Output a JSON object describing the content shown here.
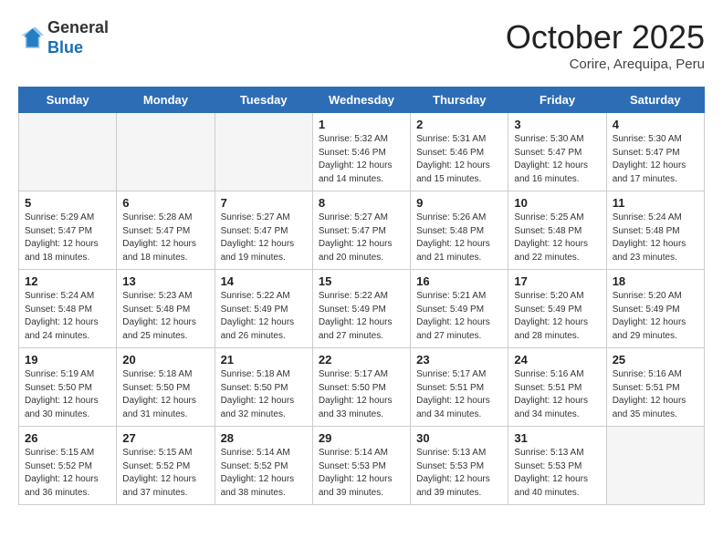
{
  "header": {
    "logo_general": "General",
    "logo_blue": "Blue",
    "month": "October 2025",
    "location": "Corire, Arequipa, Peru"
  },
  "weekdays": [
    "Sunday",
    "Monday",
    "Tuesday",
    "Wednesday",
    "Thursday",
    "Friday",
    "Saturday"
  ],
  "weeks": [
    [
      {
        "day": "",
        "info": ""
      },
      {
        "day": "",
        "info": ""
      },
      {
        "day": "",
        "info": ""
      },
      {
        "day": "1",
        "info": "Sunrise: 5:32 AM\nSunset: 5:46 PM\nDaylight: 12 hours\nand 14 minutes."
      },
      {
        "day": "2",
        "info": "Sunrise: 5:31 AM\nSunset: 5:46 PM\nDaylight: 12 hours\nand 15 minutes."
      },
      {
        "day": "3",
        "info": "Sunrise: 5:30 AM\nSunset: 5:47 PM\nDaylight: 12 hours\nand 16 minutes."
      },
      {
        "day": "4",
        "info": "Sunrise: 5:30 AM\nSunset: 5:47 PM\nDaylight: 12 hours\nand 17 minutes."
      }
    ],
    [
      {
        "day": "5",
        "info": "Sunrise: 5:29 AM\nSunset: 5:47 PM\nDaylight: 12 hours\nand 18 minutes."
      },
      {
        "day": "6",
        "info": "Sunrise: 5:28 AM\nSunset: 5:47 PM\nDaylight: 12 hours\nand 18 minutes."
      },
      {
        "day": "7",
        "info": "Sunrise: 5:27 AM\nSunset: 5:47 PM\nDaylight: 12 hours\nand 19 minutes."
      },
      {
        "day": "8",
        "info": "Sunrise: 5:27 AM\nSunset: 5:47 PM\nDaylight: 12 hours\nand 20 minutes."
      },
      {
        "day": "9",
        "info": "Sunrise: 5:26 AM\nSunset: 5:48 PM\nDaylight: 12 hours\nand 21 minutes."
      },
      {
        "day": "10",
        "info": "Sunrise: 5:25 AM\nSunset: 5:48 PM\nDaylight: 12 hours\nand 22 minutes."
      },
      {
        "day": "11",
        "info": "Sunrise: 5:24 AM\nSunset: 5:48 PM\nDaylight: 12 hours\nand 23 minutes."
      }
    ],
    [
      {
        "day": "12",
        "info": "Sunrise: 5:24 AM\nSunset: 5:48 PM\nDaylight: 12 hours\nand 24 minutes."
      },
      {
        "day": "13",
        "info": "Sunrise: 5:23 AM\nSunset: 5:48 PM\nDaylight: 12 hours\nand 25 minutes."
      },
      {
        "day": "14",
        "info": "Sunrise: 5:22 AM\nSunset: 5:49 PM\nDaylight: 12 hours\nand 26 minutes."
      },
      {
        "day": "15",
        "info": "Sunrise: 5:22 AM\nSunset: 5:49 PM\nDaylight: 12 hours\nand 27 minutes."
      },
      {
        "day": "16",
        "info": "Sunrise: 5:21 AM\nSunset: 5:49 PM\nDaylight: 12 hours\nand 27 minutes."
      },
      {
        "day": "17",
        "info": "Sunrise: 5:20 AM\nSunset: 5:49 PM\nDaylight: 12 hours\nand 28 minutes."
      },
      {
        "day": "18",
        "info": "Sunrise: 5:20 AM\nSunset: 5:49 PM\nDaylight: 12 hours\nand 29 minutes."
      }
    ],
    [
      {
        "day": "19",
        "info": "Sunrise: 5:19 AM\nSunset: 5:50 PM\nDaylight: 12 hours\nand 30 minutes."
      },
      {
        "day": "20",
        "info": "Sunrise: 5:18 AM\nSunset: 5:50 PM\nDaylight: 12 hours\nand 31 minutes."
      },
      {
        "day": "21",
        "info": "Sunrise: 5:18 AM\nSunset: 5:50 PM\nDaylight: 12 hours\nand 32 minutes."
      },
      {
        "day": "22",
        "info": "Sunrise: 5:17 AM\nSunset: 5:50 PM\nDaylight: 12 hours\nand 33 minutes."
      },
      {
        "day": "23",
        "info": "Sunrise: 5:17 AM\nSunset: 5:51 PM\nDaylight: 12 hours\nand 34 minutes."
      },
      {
        "day": "24",
        "info": "Sunrise: 5:16 AM\nSunset: 5:51 PM\nDaylight: 12 hours\nand 34 minutes."
      },
      {
        "day": "25",
        "info": "Sunrise: 5:16 AM\nSunset: 5:51 PM\nDaylight: 12 hours\nand 35 minutes."
      }
    ],
    [
      {
        "day": "26",
        "info": "Sunrise: 5:15 AM\nSunset: 5:52 PM\nDaylight: 12 hours\nand 36 minutes."
      },
      {
        "day": "27",
        "info": "Sunrise: 5:15 AM\nSunset: 5:52 PM\nDaylight: 12 hours\nand 37 minutes."
      },
      {
        "day": "28",
        "info": "Sunrise: 5:14 AM\nSunset: 5:52 PM\nDaylight: 12 hours\nand 38 minutes."
      },
      {
        "day": "29",
        "info": "Sunrise: 5:14 AM\nSunset: 5:53 PM\nDaylight: 12 hours\nand 39 minutes."
      },
      {
        "day": "30",
        "info": "Sunrise: 5:13 AM\nSunset: 5:53 PM\nDaylight: 12 hours\nand 39 minutes."
      },
      {
        "day": "31",
        "info": "Sunrise: 5:13 AM\nSunset: 5:53 PM\nDaylight: 12 hours\nand 40 minutes."
      },
      {
        "day": "",
        "info": ""
      }
    ]
  ]
}
